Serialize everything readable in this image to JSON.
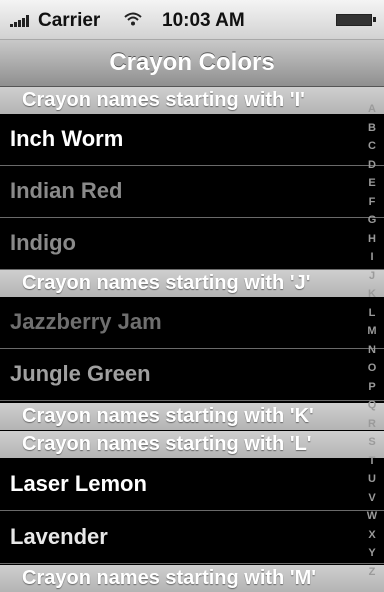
{
  "status_bar": {
    "carrier": "Carrier",
    "time": "10:03 AM"
  },
  "nav": {
    "title": "Crayon Colors"
  },
  "sections": [
    {
      "header": "Crayon names starting with 'I'",
      "rows": [
        {
          "label": "Inch Worm",
          "color": "#ffffff"
        },
        {
          "label": "Indian Red",
          "color": "#8a8a8a"
        },
        {
          "label": "Indigo",
          "color": "#8a8a8a"
        }
      ]
    },
    {
      "header": "Crayon names starting with 'J'",
      "rows": [
        {
          "label": "Jazzberry Jam",
          "color": "#6f6f6f"
        },
        {
          "label": "Jungle Green",
          "color": "#a0a0a0"
        }
      ]
    },
    {
      "header": "Crayon names starting with 'K'",
      "rows": []
    },
    {
      "header": "Crayon names starting with 'L'",
      "rows": [
        {
          "label": "Laser Lemon",
          "color": "#ffffff"
        },
        {
          "label": "Lavender",
          "color": "#e8e8e8"
        }
      ]
    },
    {
      "header": "Crayon names starting with 'M'",
      "rows": []
    }
  ],
  "index_letters": [
    "A",
    "B",
    "C",
    "D",
    "E",
    "F",
    "G",
    "H",
    "I",
    "J",
    "K",
    "L",
    "M",
    "N",
    "O",
    "P",
    "Q",
    "R",
    "S",
    "T",
    "U",
    "V",
    "W",
    "X",
    "Y",
    "Z"
  ]
}
